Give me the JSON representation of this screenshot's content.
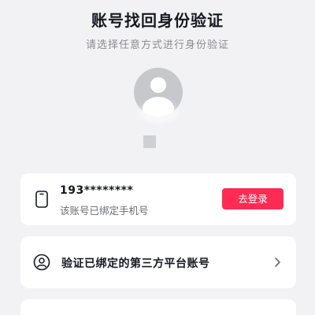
{
  "header": {
    "title": "账号找回身份验证",
    "subtitle": "请选择任意方式进行身份验证"
  },
  "profile": {
    "avatar_icon": "default-user-avatar-icon"
  },
  "options": {
    "phone": {
      "icon": "phone-icon",
      "number": "193********",
      "description": "该账号已绑定手机号",
      "action_label": "去登录",
      "action_color": "#fe2c55"
    },
    "third_party": {
      "icon": "user-circle-icon",
      "label": "验证已绑定的第三方平台账号",
      "chevron_icon": "chevron-right-icon"
    }
  },
  "colors": {
    "background": "#f2f2f4",
    "card": "#ffffff",
    "accent": "#fe2c55",
    "text_primary": "#161823",
    "text_secondary": "#8a8b91"
  }
}
